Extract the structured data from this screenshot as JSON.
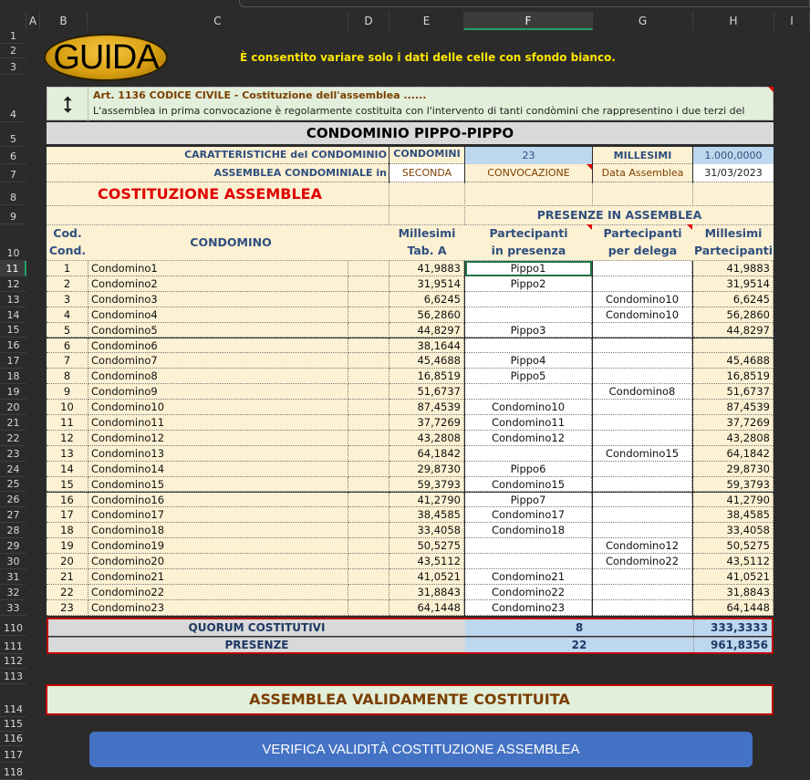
{
  "columns": [
    "A",
    "B",
    "C",
    "D",
    "E",
    "F",
    "G",
    "H",
    "I"
  ],
  "rows": [
    "1",
    "2",
    "3",
    "4",
    "5",
    "6",
    "7",
    "8",
    "9",
    "10",
    "11",
    "12",
    "13",
    "14",
    "15",
    "16",
    "17",
    "18",
    "19",
    "20",
    "21",
    "22",
    "23",
    "24",
    "25",
    "26",
    "27",
    "28",
    "29",
    "30",
    "31",
    "32",
    "33",
    "110",
    "111",
    "112",
    "113",
    "114",
    "115",
    "116",
    "117",
    "118"
  ],
  "logo": "GUIDA",
  "notice": "È consentito variare solo i dati delle celle con sfondo bianco.",
  "article": {
    "title": "Art. 1136 CODICE CIVILE  -  Costituzione dell'assemblea  ......",
    "text": "L'assemblea in prima convocazione è regolarmente costituita con l'intervento di tanti condòmini che rappresentino i due terzi del"
  },
  "condo_title": "CONDOMINIO PIPPO-PIPPO",
  "info": {
    "caratteristiche_label": "CARATTERISTICHE del CONDOMINIO",
    "condomini_label": "CONDOMINI",
    "condomini_value": "23",
    "millesimi_label": "MILLESIMI",
    "millesimi_value": "1.000,0000",
    "assemblea_label": "ASSEMBLEA CONDOMINIALE in",
    "convocazione_value": "SECONDA",
    "convocazione_label": "CONVOCAZIONE",
    "data_label": "Data Assemblea",
    "data_value": "31/03/2023"
  },
  "section_title": "COSTITUZIONE ASSEMBLEA",
  "presenze_title": "PRESENZE IN ASSEMBLEA",
  "table_headers": {
    "cod": "Cod.\nCond.",
    "condomino": "CONDOMINO",
    "millesimi": "Millesimi\nTab. A",
    "presenza": "Partecipanti\nin presenza",
    "delega": "Partecipanti\nper delega",
    "millesimi_part": "Millesimi\nPartecipanti"
  },
  "table_rows": [
    {
      "cod": "1",
      "name": "Condomino1",
      "mill": "41,9883",
      "pres": "Pippo1",
      "del": "",
      "part": "41,9883"
    },
    {
      "cod": "2",
      "name": "Condomino2",
      "mill": "31,9514",
      "pres": "Pippo2",
      "del": "",
      "part": "31,9514"
    },
    {
      "cod": "3",
      "name": "Condomino3",
      "mill": "6,6245",
      "pres": "",
      "del": "Condomino10",
      "part": "6,6245"
    },
    {
      "cod": "4",
      "name": "Condomino4",
      "mill": "56,2860",
      "pres": "",
      "del": "Condomino10",
      "part": "56,2860"
    },
    {
      "cod": "5",
      "name": "Condomino5",
      "mill": "44,8297",
      "pres": "Pippo3",
      "del": "",
      "part": "44,8297"
    },
    {
      "cod": "6",
      "name": "Condomino6",
      "mill": "38,1644",
      "pres": "",
      "del": "",
      "part": ""
    },
    {
      "cod": "7",
      "name": "Condomino7",
      "mill": "45,4688",
      "pres": "Pippo4",
      "del": "",
      "part": "45,4688"
    },
    {
      "cod": "8",
      "name": "Condomino8",
      "mill": "16,8519",
      "pres": "Pippo5",
      "del": "",
      "part": "16,8519"
    },
    {
      "cod": "9",
      "name": "Condomino9",
      "mill": "51,6737",
      "pres": "",
      "del": "Condomino8",
      "part": "51,6737"
    },
    {
      "cod": "10",
      "name": "Condomino10",
      "mill": "87,4539",
      "pres": "Condomino10",
      "del": "",
      "part": "87,4539"
    },
    {
      "cod": "11",
      "name": "Condomino11",
      "mill": "37,7269",
      "pres": "Condomino11",
      "del": "",
      "part": "37,7269"
    },
    {
      "cod": "12",
      "name": "Condomino12",
      "mill": "43,2808",
      "pres": "Condomino12",
      "del": "",
      "part": "43,2808"
    },
    {
      "cod": "13",
      "name": "Condomino13",
      "mill": "64,1842",
      "pres": "",
      "del": "Condomino15",
      "part": "64,1842"
    },
    {
      "cod": "14",
      "name": "Condomino14",
      "mill": "29,8730",
      "pres": "Pippo6",
      "del": "",
      "part": "29,8730"
    },
    {
      "cod": "15",
      "name": "Condomino15",
      "mill": "59,3793",
      "pres": "Condomino15",
      "del": "",
      "part": "59,3793"
    },
    {
      "cod": "16",
      "name": "Condomino16",
      "mill": "41,2790",
      "pres": "Pippo7",
      "del": "",
      "part": "41,2790"
    },
    {
      "cod": "17",
      "name": "Condomino17",
      "mill": "38,4585",
      "pres": "Condomino17",
      "del": "",
      "part": "38,4585"
    },
    {
      "cod": "18",
      "name": "Condomino18",
      "mill": "33,4058",
      "pres": "Condomino18",
      "del": "",
      "part": "33,4058"
    },
    {
      "cod": "19",
      "name": "Condomino19",
      "mill": "50,5275",
      "pres": "",
      "del": "Condomino12",
      "part": "50,5275"
    },
    {
      "cod": "20",
      "name": "Condomino20",
      "mill": "43,5112",
      "pres": "",
      "del": "Condomino22",
      "part": "43,5112"
    },
    {
      "cod": "21",
      "name": "Condomino21",
      "mill": "41,0521",
      "pres": "Condomino21",
      "del": "",
      "part": "41,0521"
    },
    {
      "cod": "22",
      "name": "Condomino22",
      "mill": "31,8843",
      "pres": "Condomino22",
      "del": "",
      "part": "31,8843"
    },
    {
      "cod": "23",
      "name": "Condomino23",
      "mill": "64,1448",
      "pres": "Condomino23",
      "del": "",
      "part": "64,1448"
    }
  ],
  "quorum": {
    "label": "QUORUM COSTITUTIVI",
    "count": "8",
    "millesimi": "333,3333"
  },
  "presenze": {
    "label": "PRESENZE",
    "count": "22",
    "millesimi": "961,8356"
  },
  "result": "ASSEMBLEA VALIDAMENTE COSTITUITA",
  "verify_button": "VERIFICA VALIDITÀ COSTITUZIONE ASSEMBLEA",
  "selected_column": "F",
  "selected_row": "11"
}
